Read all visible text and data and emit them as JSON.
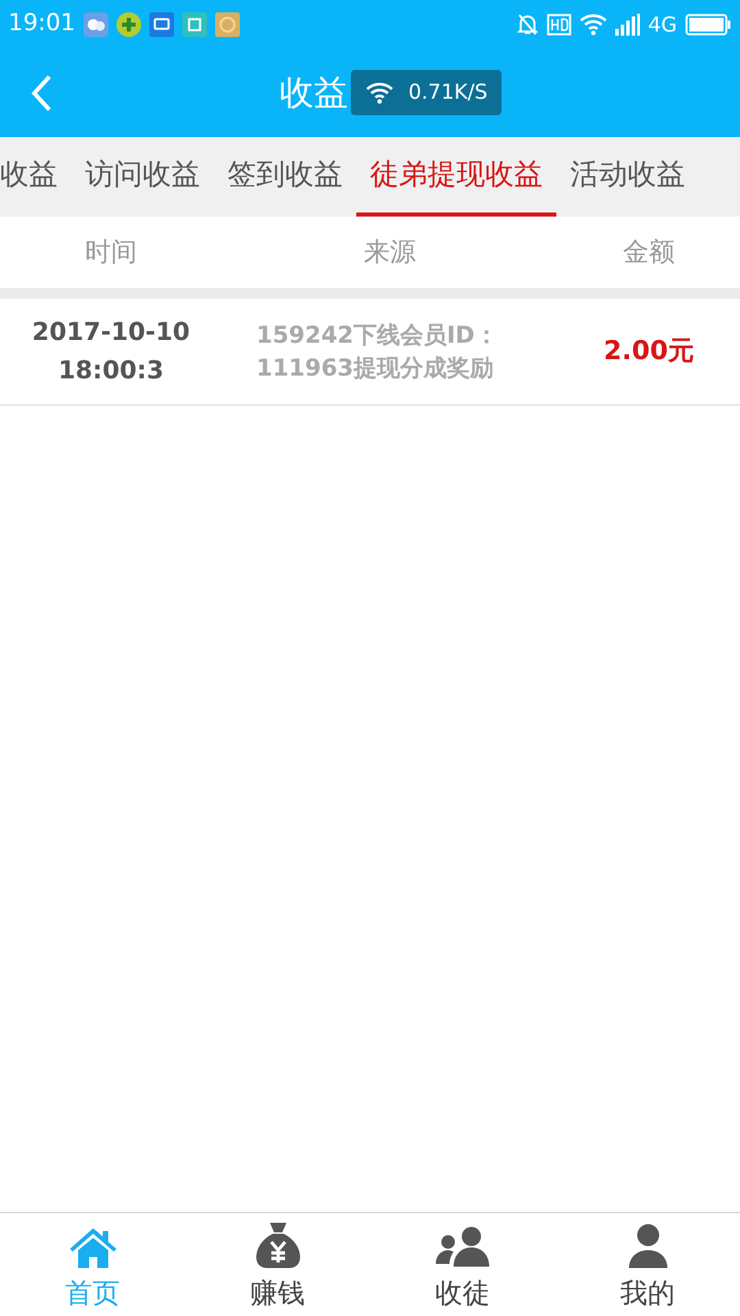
{
  "status_bar": {
    "time": "19:01",
    "network": "4G"
  },
  "header": {
    "title": "收益"
  },
  "speed_toast": {
    "text": "0.71K/S"
  },
  "tabs": [
    {
      "label": "收益",
      "selected": false
    },
    {
      "label": "访问收益",
      "selected": false
    },
    {
      "label": "签到收益",
      "selected": false
    },
    {
      "label": "徒弟提现收益",
      "selected": true
    },
    {
      "label": "活动收益",
      "selected": false
    }
  ],
  "table": {
    "columns": [
      "时间",
      "来源",
      "金额"
    ],
    "rows": [
      {
        "time": "2017-10-10 18:00:3",
        "source": "159242下线会员ID：111963提现分成奖励",
        "amount": "2.00元"
      }
    ]
  },
  "bottom_nav": [
    {
      "label": "首页",
      "selected": true
    },
    {
      "label": "赚钱",
      "selected": false
    },
    {
      "label": "收徒",
      "selected": false
    },
    {
      "label": "我的",
      "selected": false
    }
  ]
}
